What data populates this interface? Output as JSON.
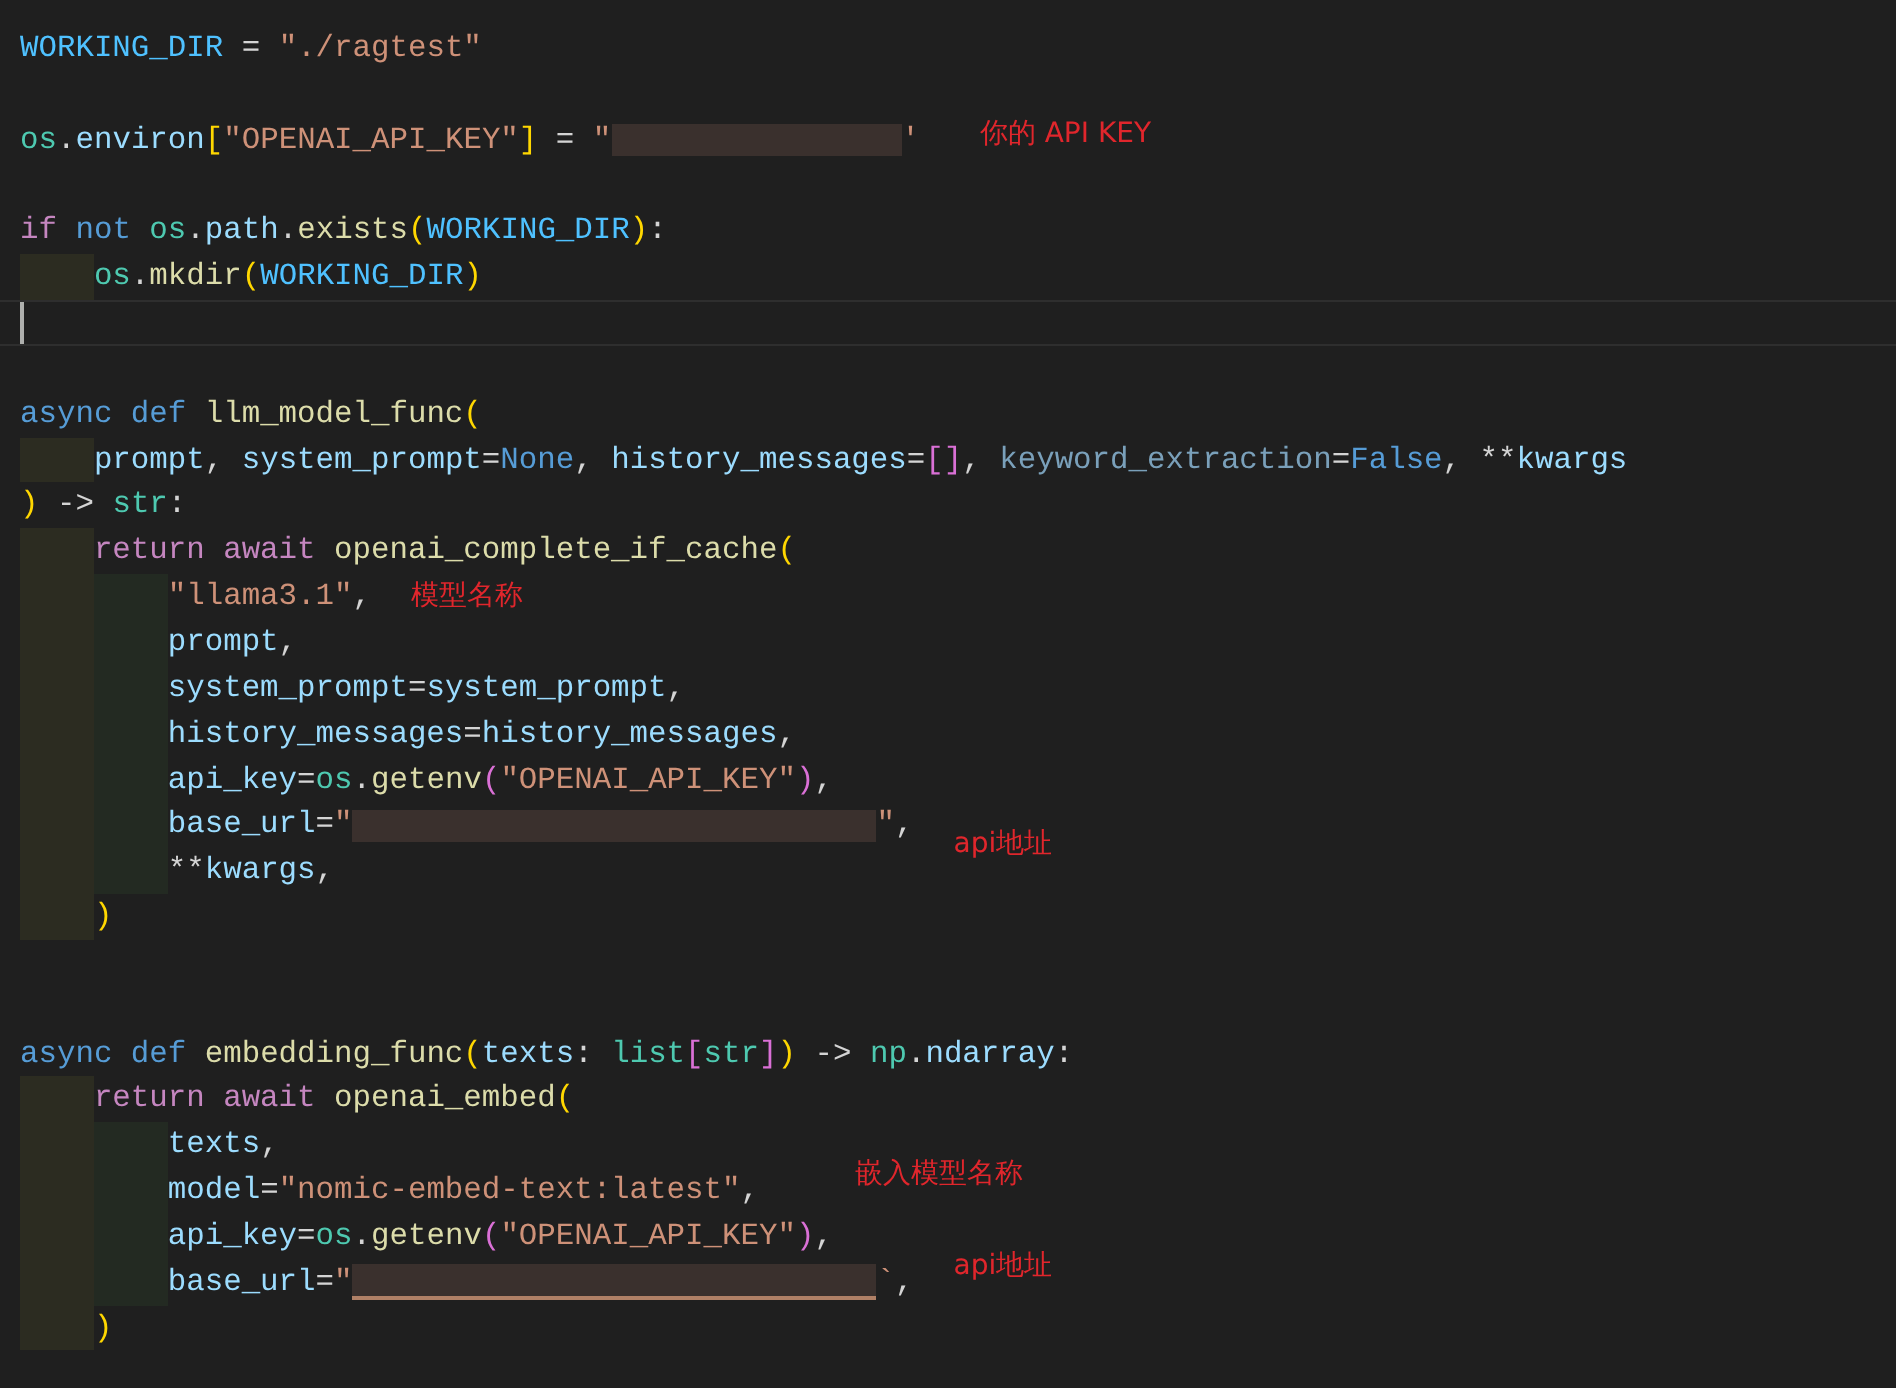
{
  "editor": {
    "lines": [
      {
        "kind": "code",
        "tokens": [
          {
            "kind": "const",
            "text": "WORKING_DIR"
          },
          {
            "kind": "plain",
            "text": " = "
          },
          {
            "kind": "str",
            "text": "\"./ragtest\""
          }
        ]
      },
      {
        "kind": "blank"
      },
      {
        "kind": "code",
        "tokens": [
          {
            "kind": "mod",
            "text": "os"
          },
          {
            "kind": "plain",
            "text": "."
          },
          {
            "kind": "var",
            "text": "environ"
          },
          {
            "kind": "b1",
            "text": "["
          },
          {
            "kind": "str",
            "text": "\"OPENAI_API_KEY\""
          },
          {
            "kind": "b1",
            "text": "]"
          },
          {
            "kind": "plain",
            "text": " = "
          },
          {
            "kind": "str",
            "text": "\""
          },
          {
            "kind": "redacted"
          },
          {
            "kind": "str",
            "text": "'"
          }
        ],
        "note": "你的 API KEY"
      },
      {
        "kind": "blank"
      },
      {
        "kind": "code",
        "tokens": [
          {
            "kind": "ctl",
            "text": "if "
          },
          {
            "kind": "kw",
            "text": "not "
          },
          {
            "kind": "mod",
            "text": "os"
          },
          {
            "kind": "plain",
            "text": "."
          },
          {
            "kind": "var",
            "text": "path"
          },
          {
            "kind": "plain",
            "text": "."
          },
          {
            "kind": "fn",
            "text": "exists"
          },
          {
            "kind": "b1",
            "text": "("
          },
          {
            "kind": "const",
            "text": "WORKING_DIR"
          },
          {
            "kind": "b1",
            "text": ")"
          },
          {
            "kind": "plain",
            "text": ":"
          }
        ],
        "children": [
          {
            "kind": "code",
            "tokens": [
              {
                "kind": "mod",
                "text": "os"
              },
              {
                "kind": "plain",
                "text": "."
              },
              {
                "kind": "fn",
                "text": "mkdir"
              },
              {
                "kind": "b1",
                "text": "("
              },
              {
                "kind": "const",
                "text": "WORKING_DIR"
              },
              {
                "kind": "b1",
                "text": ")"
              }
            ]
          }
        ]
      },
      {
        "kind": "blank",
        "cursor": true
      },
      {
        "kind": "blank"
      },
      {
        "kind": "code",
        "tokens": [
          {
            "kind": "kw",
            "text": "async def "
          },
          {
            "kind": "fn",
            "text": "llm_model_func"
          },
          {
            "kind": "b1",
            "text": "("
          }
        ],
        "children": [
          {
            "kind": "code",
            "tokens": [
              {
                "kind": "var",
                "text": "prompt"
              },
              {
                "kind": "plain",
                "text": ", "
              },
              {
                "kind": "var",
                "text": "system_prompt"
              },
              {
                "kind": "plain",
                "text": "="
              },
              {
                "kind": "kw",
                "text": "None"
              },
              {
                "kind": "plain",
                "text": ", "
              },
              {
                "kind": "var",
                "text": "history_messages"
              },
              {
                "kind": "plain",
                "text": "="
              },
              {
                "kind": "b2",
                "text": "[]"
              },
              {
                "kind": "plain",
                "text": ", "
              },
              {
                "kind": "dim",
                "text": "keyword_extraction"
              },
              {
                "kind": "plain",
                "text": "="
              },
              {
                "kind": "kw",
                "text": "False"
              },
              {
                "kind": "plain",
                "text": ", **"
              },
              {
                "kind": "var",
                "text": "kwargs"
              }
            ]
          }
        ]
      },
      {
        "kind": "code",
        "tokens": [
          {
            "kind": "b1",
            "text": ")"
          },
          {
            "kind": "plain",
            "text": " -> "
          },
          {
            "kind": "mod",
            "text": "str"
          },
          {
            "kind": "plain",
            "text": ":"
          }
        ],
        "children": [
          {
            "kind": "code",
            "tokens": [
              {
                "kind": "ctl",
                "text": "return await "
              },
              {
                "kind": "fn",
                "text": "openai_complete_if_cache"
              },
              {
                "kind": "b1",
                "text": "("
              }
            ],
            "children": [
              {
                "kind": "code",
                "tokens": [
                  {
                    "kind": "str",
                    "text": "\"llama3.1\""
                  },
                  {
                    "kind": "plain",
                    "text": ","
                  }
                ],
                "note": "模型名称"
              },
              {
                "kind": "code",
                "tokens": [
                  {
                    "kind": "var",
                    "text": "prompt"
                  },
                  {
                    "kind": "plain",
                    "text": ","
                  }
                ]
              },
              {
                "kind": "code",
                "tokens": [
                  {
                    "kind": "var",
                    "text": "system_prompt"
                  },
                  {
                    "kind": "plain",
                    "text": "="
                  },
                  {
                    "kind": "var",
                    "text": "system_prompt"
                  },
                  {
                    "kind": "plain",
                    "text": ","
                  }
                ]
              },
              {
                "kind": "code",
                "tokens": [
                  {
                    "kind": "var",
                    "text": "history_messages"
                  },
                  {
                    "kind": "plain",
                    "text": "="
                  },
                  {
                    "kind": "var",
                    "text": "history_messages"
                  },
                  {
                    "kind": "plain",
                    "text": ","
                  }
                ]
              },
              {
                "kind": "code",
                "tokens": [
                  {
                    "kind": "var",
                    "text": "api_key"
                  },
                  {
                    "kind": "plain",
                    "text": "="
                  },
                  {
                    "kind": "mod",
                    "text": "os"
                  },
                  {
                    "kind": "plain",
                    "text": "."
                  },
                  {
                    "kind": "fn",
                    "text": "getenv"
                  },
                  {
                    "kind": "b2",
                    "text": "("
                  },
                  {
                    "kind": "str",
                    "text": "\"OPENAI_API_KEY\""
                  },
                  {
                    "kind": "b2",
                    "text": ")"
                  },
                  {
                    "kind": "plain",
                    "text": ","
                  }
                ]
              },
              {
                "kind": "code",
                "tokens": [
                  {
                    "kind": "var",
                    "text": "base_url"
                  },
                  {
                    "kind": "plain",
                    "text": "="
                  },
                  {
                    "kind": "str",
                    "text": "\""
                  },
                  {
                    "kind": "redacted"
                  },
                  {
                    "kind": "str",
                    "text": "\""
                  },
                  {
                    "kind": "plain",
                    "text": ","
                  }
                ],
                "note": "api地址"
              },
              {
                "kind": "code",
                "tokens": [
                  {
                    "kind": "plain",
                    "text": "**"
                  },
                  {
                    "kind": "var",
                    "text": "kwargs"
                  },
                  {
                    "kind": "plain",
                    "text": ","
                  }
                ]
              }
            ]
          },
          {
            "kind": "code",
            "tokens": [
              {
                "kind": "b1",
                "text": ")"
              }
            ]
          }
        ]
      },
      {
        "kind": "blank"
      },
      {
        "kind": "blank"
      },
      {
        "kind": "code",
        "tokens": [
          {
            "kind": "kw",
            "text": "async def "
          },
          {
            "kind": "fn",
            "text": "embedding_func"
          },
          {
            "kind": "b1",
            "text": "("
          },
          {
            "kind": "var",
            "text": "texts"
          },
          {
            "kind": "plain",
            "text": ": "
          },
          {
            "kind": "mod",
            "text": "list"
          },
          {
            "kind": "b2",
            "text": "["
          },
          {
            "kind": "mod",
            "text": "str"
          },
          {
            "kind": "b2",
            "text": "]"
          },
          {
            "kind": "b1",
            "text": ")"
          },
          {
            "kind": "plain",
            "text": " -> "
          },
          {
            "kind": "mod",
            "text": "np"
          },
          {
            "kind": "plain",
            "text": "."
          },
          {
            "kind": "var",
            "text": "ndarray"
          },
          {
            "kind": "plain",
            "text": ":"
          }
        ],
        "children": [
          {
            "kind": "code",
            "tokens": [
              {
                "kind": "ctl",
                "text": "return await "
              },
              {
                "kind": "fn",
                "text": "openai_embed"
              },
              {
                "kind": "b1",
                "text": "("
              }
            ],
            "children": [
              {
                "kind": "code",
                "tokens": [
                  {
                    "kind": "var",
                    "text": "texts"
                  },
                  {
                    "kind": "plain",
                    "text": ","
                  }
                ]
              },
              {
                "kind": "code",
                "tokens": [
                  {
                    "kind": "var",
                    "text": "model"
                  },
                  {
                    "kind": "plain",
                    "text": "="
                  },
                  {
                    "kind": "str",
                    "text": "\"nomic-embed-text:latest\""
                  },
                  {
                    "kind": "plain",
                    "text": ","
                  }
                ],
                "note": "嵌入模型名称"
              },
              {
                "kind": "code",
                "tokens": [
                  {
                    "kind": "var",
                    "text": "api_key"
                  },
                  {
                    "kind": "plain",
                    "text": "="
                  },
                  {
                    "kind": "mod",
                    "text": "os"
                  },
                  {
                    "kind": "plain",
                    "text": "."
                  },
                  {
                    "kind": "fn",
                    "text": "getenv"
                  },
                  {
                    "kind": "b2",
                    "text": "("
                  },
                  {
                    "kind": "str",
                    "text": "\"OPENAI_API_KEY\""
                  },
                  {
                    "kind": "b2",
                    "text": ")"
                  },
                  {
                    "kind": "plain",
                    "text": ","
                  }
                ]
              },
              {
                "kind": "code",
                "tokens": [
                  {
                    "kind": "var",
                    "text": "base_url"
                  },
                  {
                    "kind": "plain",
                    "text": "="
                  },
                  {
                    "kind": "str",
                    "text": "\""
                  },
                  {
                    "kind": "redacted"
                  },
                  {
                    "kind": "str",
                    "text": "`"
                  },
                  {
                    "kind": "plain",
                    "text": ","
                  }
                ],
                "note": "api地址"
              }
            ]
          },
          {
            "kind": "code",
            "tokens": [
              {
                "kind": "b1",
                "text": ")"
              }
            ]
          }
        ]
      }
    ]
  }
}
